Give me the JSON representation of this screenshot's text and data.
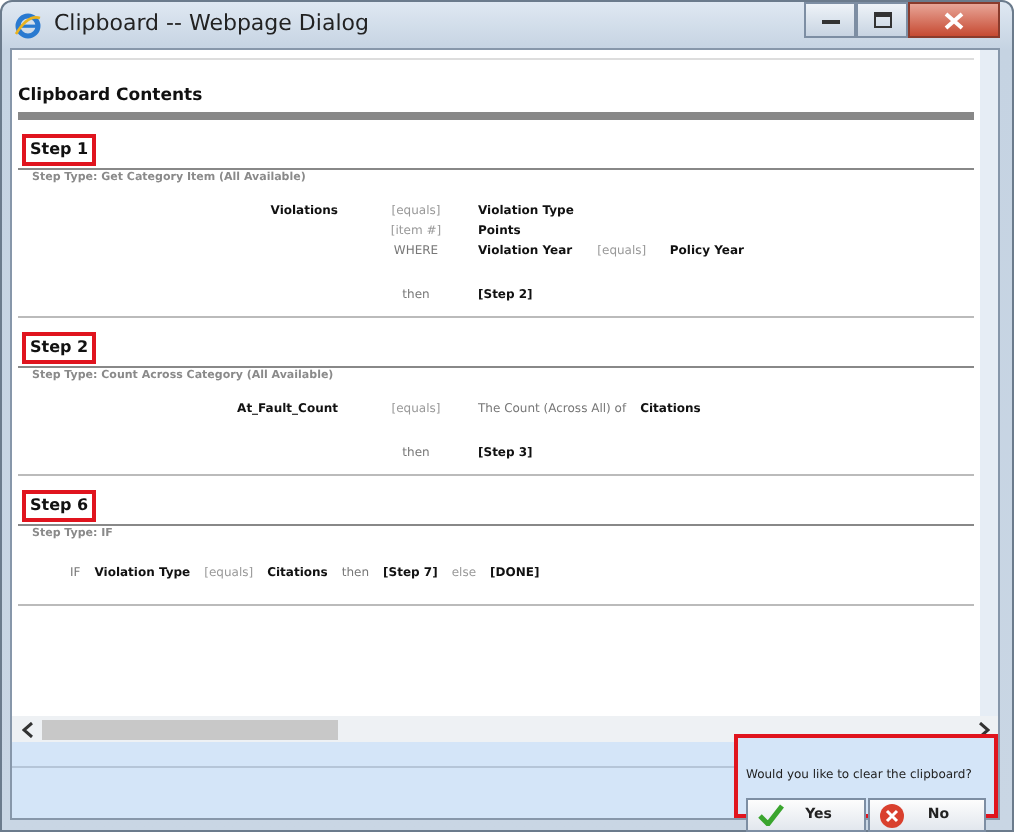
{
  "window": {
    "title": "Clipboard -- Webpage Dialog"
  },
  "heading": "Clipboard Contents",
  "steps": [
    {
      "title": "Step 1",
      "highlighted": true,
      "type_text": "Step Type: Get Category Item (All Available)",
      "kind": "grid",
      "rows": [
        {
          "subject": [
            {
              "text": "Violations",
              "kind": "value"
            }
          ],
          "operator": [
            {
              "text": "[equals]",
              "kind": "operator"
            }
          ],
          "value": [
            {
              "text": "Violation Type",
              "kind": "value"
            }
          ]
        },
        {
          "operator": [
            {
              "text": "[item #]",
              "kind": "operator"
            }
          ],
          "value": [
            {
              "text": "Points",
              "kind": "value"
            }
          ]
        },
        {
          "operator": [
            {
              "text": "WHERE",
              "kind": "keyword"
            }
          ],
          "value": [
            {
              "text": "Violation Year",
              "kind": "value"
            }
          ],
          "operator_2": [
            {
              "text": "[equals]",
              "kind": "operator"
            }
          ],
          "value_2": [
            {
              "text": "Policy Year",
              "kind": "value"
            }
          ]
        }
      ],
      "then_row": {
        "operator": [
          {
            "text": "then",
            "kind": "keyword"
          }
        ],
        "value": [
          {
            "text": "[Step 2]",
            "kind": "ref"
          }
        ]
      }
    },
    {
      "title": "Step 2",
      "highlighted": true,
      "type_text": "Step Type: Count Across Category (All Available)",
      "kind": "grid",
      "rows": [
        {
          "subject": [
            {
              "text": "At_Fault_Count",
              "kind": "value"
            }
          ],
          "operator": [
            {
              "text": "[equals]",
              "kind": "operator"
            }
          ],
          "value": [
            {
              "text": "The Count (Across All) of",
              "kind": "keyword"
            },
            {
              "text": "Citations",
              "kind": "value"
            }
          ]
        }
      ],
      "then_row": {
        "operator": [
          {
            "text": "then",
            "kind": "keyword"
          }
        ],
        "value": [
          {
            "text": "[Step 3]",
            "kind": "ref"
          }
        ]
      }
    },
    {
      "title": "Step 6",
      "highlighted": true,
      "type_text": "Step Type: IF",
      "kind": "inline",
      "tokens": [
        {
          "text": "IF",
          "kind": "keyword"
        },
        {
          "text": "Violation Type",
          "kind": "value"
        },
        {
          "text": "[equals]",
          "kind": "operator"
        },
        {
          "text": "Citations",
          "kind": "value"
        },
        {
          "text": "then",
          "kind": "keyword"
        },
        {
          "text": "[Step 7]",
          "kind": "ref"
        },
        {
          "text": "else",
          "kind": "operator"
        },
        {
          "text": "[DONE]",
          "kind": "ref"
        }
      ]
    }
  ],
  "prompt": {
    "text": "Would you like to clear the clipboard?",
    "highlighted": true,
    "buttons": [
      {
        "label": "Yes",
        "kind": "confirm"
      },
      {
        "label": "No",
        "kind": "cancel"
      }
    ]
  }
}
